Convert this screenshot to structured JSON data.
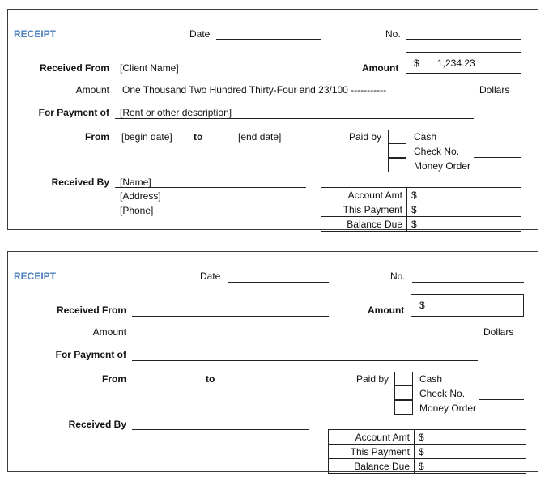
{
  "receipts": [
    {
      "title": "RECEIPT",
      "date_label": "Date",
      "date_value": "",
      "no_label": "No.",
      "no_value": "",
      "received_from_label": "Received From",
      "received_from_value": "[Client Name]",
      "amount_label": "Amount",
      "amount_currency": "$",
      "amount_value": "1,234.23",
      "amount_words_label": "Amount",
      "amount_words_value": "One Thousand Two Hundred Thirty-Four and 23/100 -----------",
      "dollars_label": "Dollars",
      "for_payment_label": "For Payment of",
      "for_payment_value": "[Rent or other description]",
      "from_label": "From",
      "from_value": "[begin date]",
      "to_label": "to",
      "to_value": "[end date]",
      "paid_by_label": "Paid by",
      "payment_methods": [
        "Cash",
        "Check No.",
        "Money Order"
      ],
      "received_by_label": "Received By",
      "received_by_name": "[Name]",
      "received_by_address": "[Address]",
      "received_by_phone": "[Phone]",
      "summary": [
        {
          "label": "Account Amt",
          "currency": "$",
          "value": ""
        },
        {
          "label": "This Payment",
          "currency": "$",
          "value": ""
        },
        {
          "label": "Balance Due",
          "currency": "$",
          "value": ""
        }
      ]
    },
    {
      "title": "RECEIPT",
      "date_label": "Date",
      "date_value": "",
      "no_label": "No.",
      "no_value": "",
      "received_from_label": "Received From",
      "received_from_value": "",
      "amount_label": "Amount",
      "amount_currency": "$",
      "amount_value": "",
      "amount_words_label": "Amount",
      "amount_words_value": "",
      "dollars_label": "Dollars",
      "for_payment_label": "For Payment of",
      "for_payment_value": "",
      "from_label": "From",
      "from_value": "",
      "to_label": "to",
      "to_value": "",
      "paid_by_label": "Paid by",
      "payment_methods": [
        "Cash",
        "Check No.",
        "Money Order"
      ],
      "received_by_label": "Received By",
      "received_by_name": "",
      "received_by_address": "",
      "received_by_phone": "",
      "summary": [
        {
          "label": "Account Amt",
          "currency": "$",
          "value": ""
        },
        {
          "label": "This Payment",
          "currency": "$",
          "value": ""
        },
        {
          "label": "Balance Due",
          "currency": "$",
          "value": ""
        }
      ]
    }
  ]
}
